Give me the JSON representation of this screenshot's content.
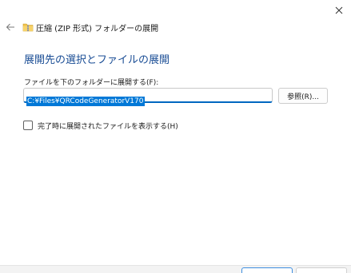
{
  "window": {
    "title": "圧縮 (ZIP 形式) フォルダーの展開"
  },
  "main": {
    "heading": "展開先の選択とファイルの展開",
    "path_label": "ファイルを下のフォルダーに展開する(F):",
    "path_value": "C:¥Files¥QRCodeGeneratorV170",
    "browse_label": "参照(R)...",
    "show_files_label": "完了時に展開されたファイルを表示する(H)",
    "show_files_checked": false
  },
  "icons": {
    "close": "close-icon",
    "back": "back-arrow-icon",
    "folder": "zip-folder-icon"
  },
  "colors": {
    "heading": "#1a4d95",
    "selection": "#0078d7",
    "input_focus": "#0067c0"
  }
}
